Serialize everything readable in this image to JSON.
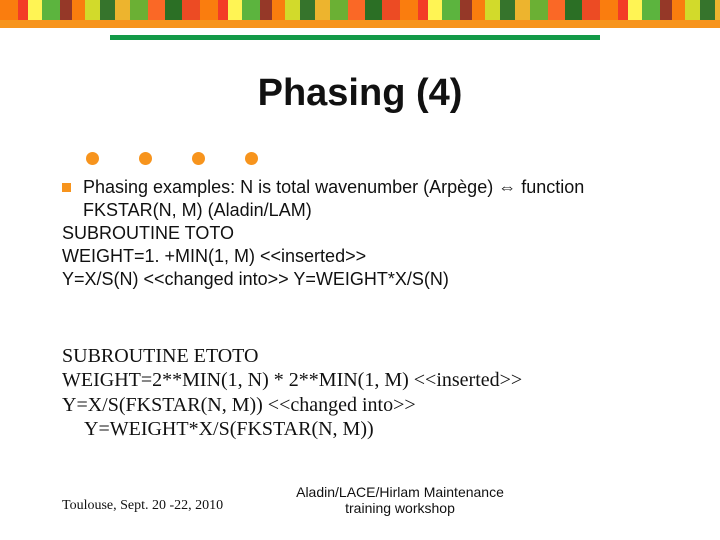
{
  "title": "Phasing (4)",
  "bullet": "Phasing examples: N is total wavenumber (Arpège) ⇔ function FKSTAR(N, M)  (Aladin/LAM)",
  "codeA": {
    "l1": "SUBROUTINE TOTO",
    "l2": "WEIGHT=1. +MIN(1, M) <<inserted>>",
    "l3": "Y=X/S(N) <<changed into>> Y=WEIGHT*X/S(N)"
  },
  "codeB": {
    "l1": "SUBROUTINE ETOTO",
    "l2": "WEIGHT=2**MIN(1, N) * 2**MIN(1, M) <<inserted>>",
    "l3": "Y=X/S(FKSTAR(N, M)) <<changed into>>",
    "l4": "Y=WEIGHT*X/S(FKSTAR(N, M))"
  },
  "footer": {
    "left": "Toulouse, Sept. 20 -22, 2010",
    "center_l1": "Aladin/LACE/Hirlam Maintenance",
    "center_l2": "training workshop"
  }
}
